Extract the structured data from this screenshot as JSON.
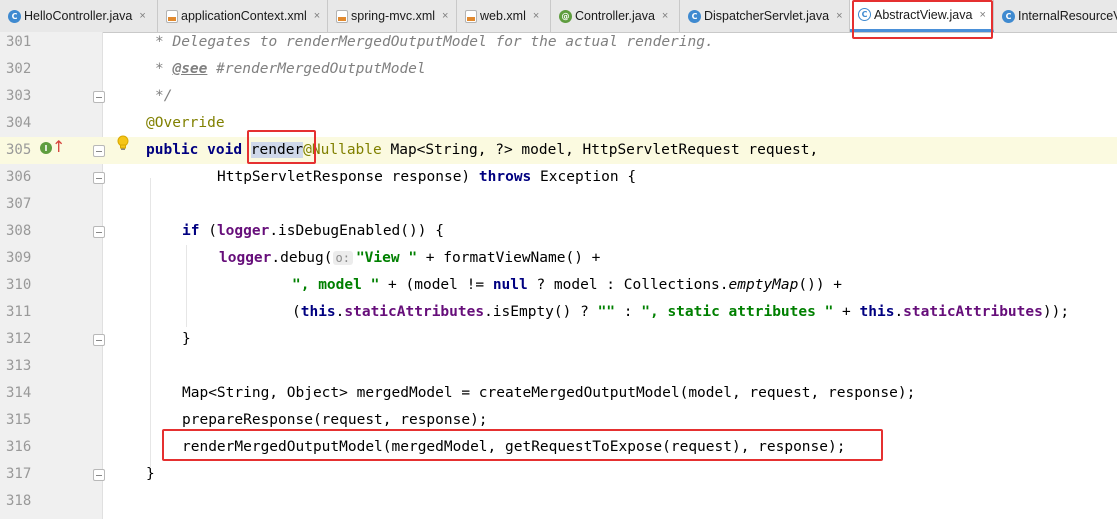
{
  "tabs": [
    {
      "label": "HelloController.java",
      "icon": "class-icon"
    },
    {
      "label": "applicationContext.xml",
      "icon": "xml-file-icon"
    },
    {
      "label": "spring-mvc.xml",
      "icon": "xml-file-icon"
    },
    {
      "label": "web.xml",
      "icon": "xml-file-icon"
    },
    {
      "label": "Controller.java",
      "icon": "annotation-icon"
    },
    {
      "label": "DispatcherServlet.java",
      "icon": "class-icon"
    },
    {
      "label": "AbstractView.java",
      "icon": "abstract-class-icon",
      "active": true
    },
    {
      "label": "InternalResourceV",
      "icon": "class-icon"
    }
  ],
  "close_glyph": "×",
  "editor": {
    "line_numbers": [
      "301",
      "302",
      "303",
      "304",
      "305",
      "306",
      "307",
      "308",
      "309",
      "310",
      "311",
      "312",
      "313",
      "314",
      "315",
      "316",
      "317",
      "318"
    ],
    "caret_line": "305",
    "gutter_marker_305": "I",
    "param_hint": "o:",
    "code": {
      "l301": "* Delegates to renderMergedOutputModel for the actual rendering.",
      "l302_star": "* ",
      "l302_tag": "@see",
      "l302_rest": " #renderMergedOutputModel",
      "l303": "*/",
      "l304": "@Override",
      "l305_public": "public",
      "l305_void": "void",
      "l305_render": "render",
      "l305_nullable": "@Nullable",
      "l305_rest": " Map<String, ?> model, HttpServletRequest request,",
      "l306_a": "HttpServletResponse response) ",
      "l306_throws": "throws",
      "l306_b": " Exception {",
      "l308_if": "if",
      "l308_a": " (",
      "l308_logger": "logger",
      "l308_b": ".isDebugEnabled()) {",
      "l309_logger": "logger",
      "l309_a": ".debug(",
      "l309_str": "\"View \"",
      "l309_b": " + formatViewName() +",
      "l310_str1": "\", model \"",
      "l310_a": " + (model != ",
      "l310_null": "null",
      "l310_b": " ? model : Collections.",
      "l310_it": "emptyMap",
      "l310_c": "()) +",
      "l311_a": "(",
      "l311_this1": "this",
      "l311_dot1": ".",
      "l311_fld1": "staticAttributes",
      "l311_b": ".isEmpty() ? ",
      "l311_str1": "\"\"",
      "l311_c": " : ",
      "l311_str2": "\", static attributes \"",
      "l311_d": " + ",
      "l311_this2": "this",
      "l311_dot2": ".",
      "l311_fld2": "staticAttributes",
      "l311_e": "));",
      "l312": "}",
      "l314": "Map<String, Object> mergedModel = createMergedOutputModel(model, request, response);",
      "l315": "prepareResponse(request, response);",
      "l316": "renderMergedOutputModel(mergedModel, getRequestToExpose(request), response);",
      "l317": "}"
    }
  },
  "colors": {
    "keyword": "#000080",
    "annotation": "#808000",
    "string": "#008000",
    "field": "#660e7a",
    "comment": "#808080",
    "highlight_box": "#e53030"
  }
}
